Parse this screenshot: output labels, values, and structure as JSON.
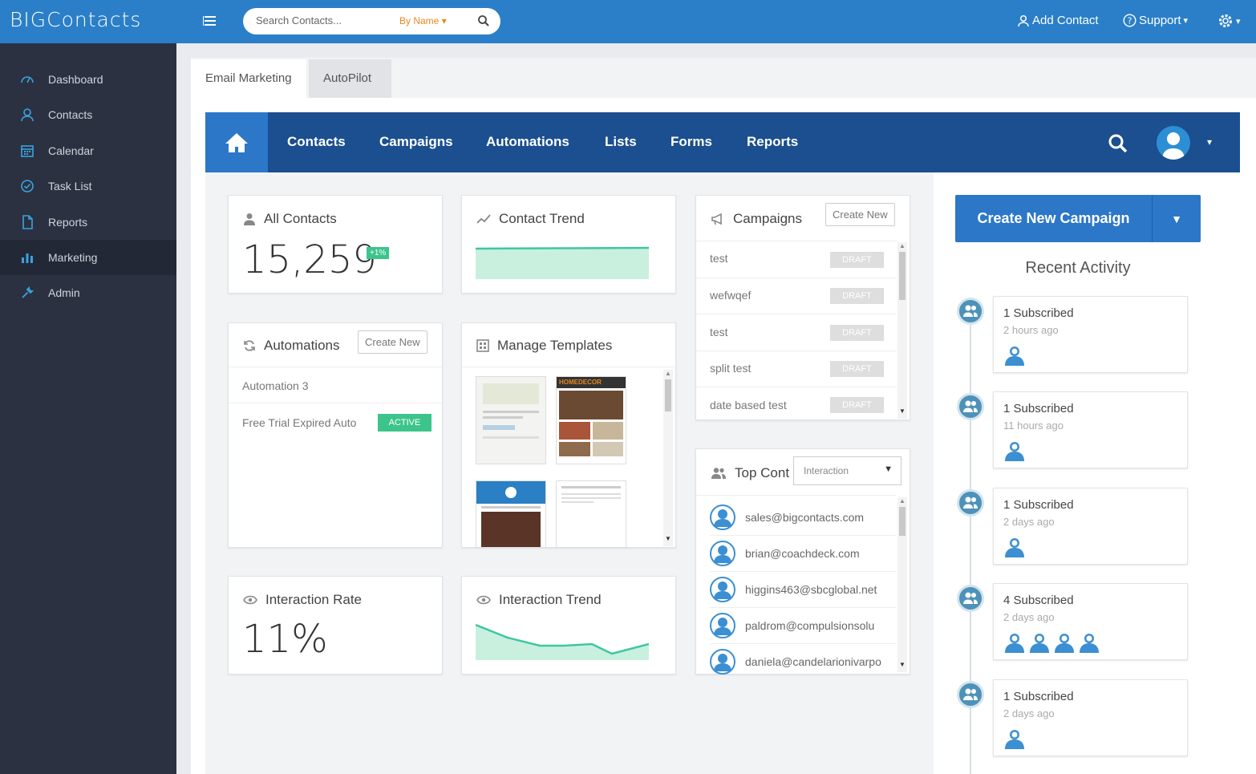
{
  "app": {
    "logo_text": "BIGContacts",
    "search": {
      "placeholder": "Search Contacts...",
      "scope": "By Name"
    },
    "top_links": {
      "add_contact": "Add Contact",
      "support": "Support"
    }
  },
  "sidebar": {
    "items": [
      {
        "label": "Dashboard",
        "icon": "gauge-icon"
      },
      {
        "label": "Contacts",
        "icon": "user-icon"
      },
      {
        "label": "Calendar",
        "icon": "calendar-icon"
      },
      {
        "label": "Task List",
        "icon": "check-circle-icon"
      },
      {
        "label": "Reports",
        "icon": "document-icon"
      },
      {
        "label": "Marketing",
        "icon": "bar-chart-icon",
        "active": true
      },
      {
        "label": "Admin",
        "icon": "wrench-icon"
      }
    ]
  },
  "tabs": [
    "Email Marketing",
    "AutoPilot"
  ],
  "nav": [
    "Contacts",
    "Campaigns",
    "Automations",
    "Lists",
    "Forms",
    "Reports"
  ],
  "cards": {
    "all_contacts": {
      "title": "All Contacts",
      "value": "15,259",
      "badge": "+1%"
    },
    "contact_trend": {
      "title": "Contact Trend"
    },
    "automations": {
      "title": "Automations",
      "create_label": "Create New",
      "items": [
        {
          "name": "Automation 3",
          "status": ""
        },
        {
          "name": "Free Trial Expired Auto",
          "status": "ACTIVE"
        }
      ]
    },
    "templates": {
      "title": "Manage Templates",
      "thumb_brand": "HOMEDECOR"
    },
    "interaction_rate": {
      "title": "Interaction Rate",
      "value": "11%"
    },
    "interaction_trend": {
      "title": "Interaction Trend"
    },
    "campaigns": {
      "title": "Campaigns",
      "create_label": "Create New",
      "items": [
        {
          "name": "test",
          "status": "DRAFT"
        },
        {
          "name": "wefwqef",
          "status": "DRAFT"
        },
        {
          "name": "test",
          "status": "DRAFT"
        },
        {
          "name": "split test",
          "status": "DRAFT"
        },
        {
          "name": "date based test",
          "status": "DRAFT"
        }
      ]
    },
    "top_contacts": {
      "title": "Top Cont",
      "filter": "Interaction",
      "items": [
        "sales@bigcontacts.com",
        "brian@coachdeck.com",
        "higgins463@sbcglobal.net",
        "paldrom@compulsionsolu",
        "daniela@candelarionivarpo"
      ]
    }
  },
  "right": {
    "create_campaign": "Create New Campaign",
    "recent_title": "Recent Activity",
    "activity": [
      {
        "title": "1 Subscribed",
        "time": "2 hours ago",
        "count": 1
      },
      {
        "title": "1 Subscribed",
        "time": "11 hours ago",
        "count": 1
      },
      {
        "title": "1 Subscribed",
        "time": "2 days ago",
        "count": 1
      },
      {
        "title": "4 Subscribed",
        "time": "2 days ago",
        "count": 4
      },
      {
        "title": "1 Subscribed",
        "time": "2 days ago",
        "count": 1
      }
    ]
  },
  "colors": {
    "topbar": "#2a7fc8",
    "sidebar": "#2b3141",
    "navbar": "#1b4f8f",
    "accent": "#2c77c8",
    "success": "#3cc48b",
    "trend_fill": "#c9f0df",
    "trend_line": "#3ec7a0"
  }
}
